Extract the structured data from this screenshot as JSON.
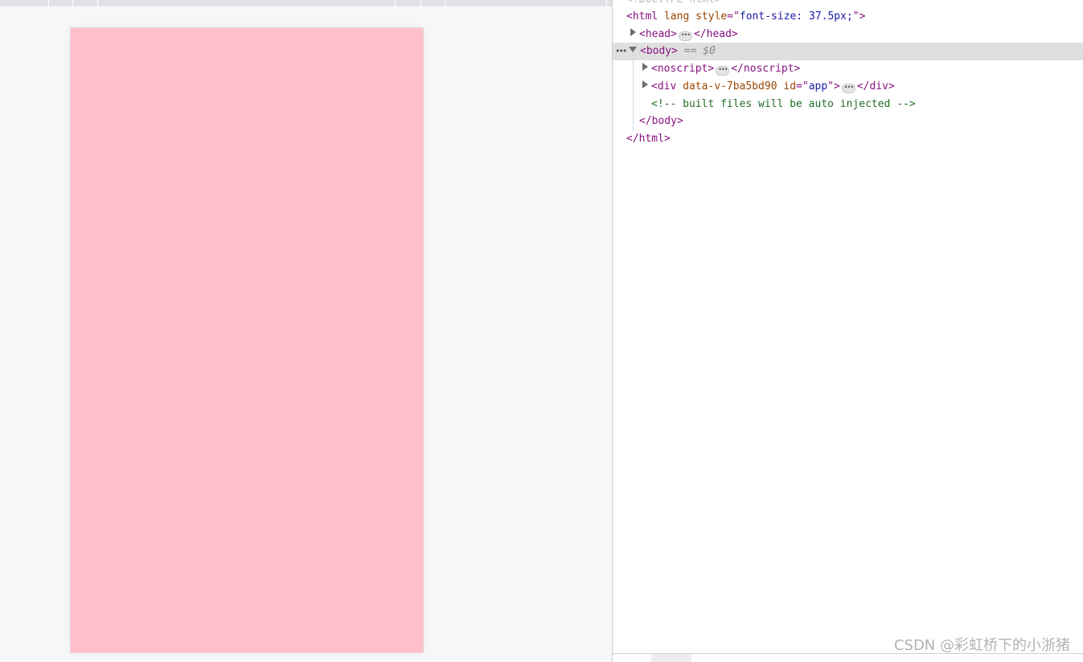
{
  "elements_tree": {
    "doctype": "<!DOCTYPE html>",
    "html_open": {
      "tag_open": "<html",
      "attr_lang": "lang",
      "attr_style_name": "style",
      "attr_style_eq": "=\"",
      "attr_style_value": "font-size: 37.5px;",
      "attr_style_close": "\"",
      "tag_close": ">"
    },
    "head": {
      "open": "<head>",
      "close": "</head>",
      "ellipsis": "•••"
    },
    "body_selected": {
      "dots": "•••",
      "open": "<body>",
      "eq_marker": "== $0"
    },
    "noscript": {
      "open": "<noscript>",
      "close": "</noscript>",
      "ellipsis": "•••"
    },
    "app_div": {
      "tag_open": "<div",
      "attr_data_v": "data-v-7ba5bd90",
      "attr_id_name": "id",
      "attr_id_eq": "=\"",
      "attr_id_value": "app",
      "attr_id_close": "\"",
      "tag_close": ">",
      "ellipsis": "•••",
      "close": "</div>"
    },
    "comment": "<!-- built files will be auto injected -->",
    "body_close": "</body>",
    "html_close": "</html>"
  },
  "viewport": {
    "screen_color": "#ffc0cb"
  },
  "watermark": "CSDN @彩虹桥下的小浙猪"
}
